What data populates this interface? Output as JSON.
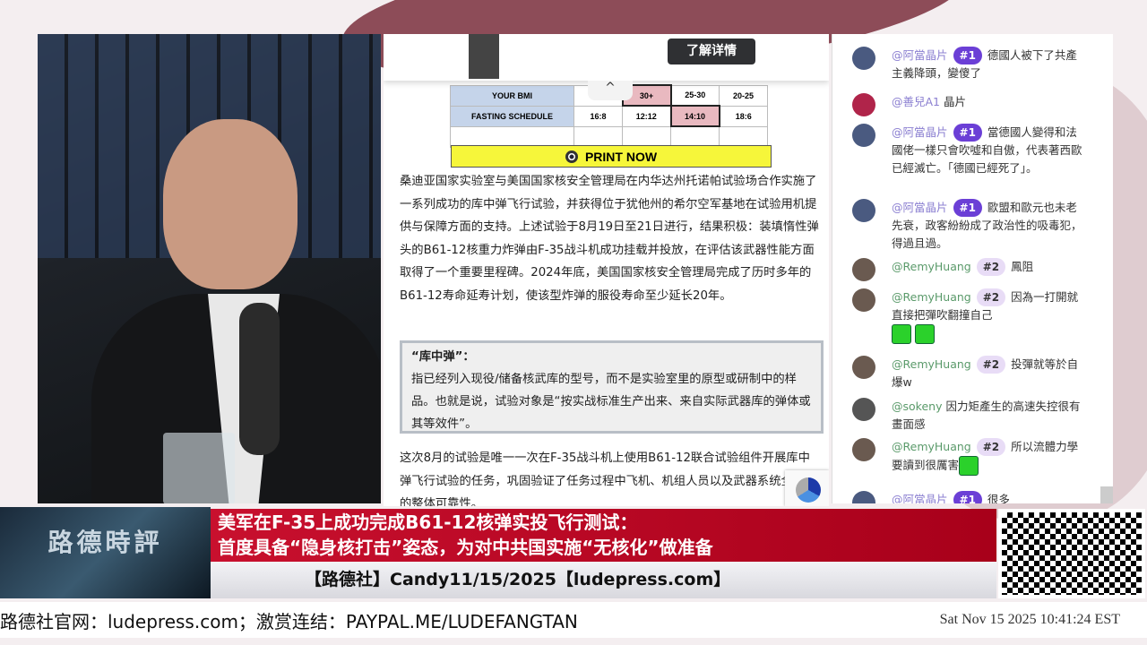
{
  "ad": {
    "button_label": "了解详情"
  },
  "bmi_table": {
    "row1": {
      "label": "YOUR BMI",
      "cells": [
        "",
        "30+",
        "25-30",
        "20-25"
      ]
    },
    "row2": {
      "label": "FASTING SCHEDULE",
      "cells": [
        "16:8",
        "12:12",
        "14:10",
        "18:6"
      ]
    },
    "print_label": "PRINT NOW",
    "collapse_icon": "^"
  },
  "article": {
    "paragraph1": "桑迪亚国家实验室与美国国家核安全管理局在内华达州托诺帕试验场合作实施了一系列成功的库中弹飞行试验，并获得位于犹他州的希尔空军基地在试验用机提供与保障方面的支持。上述试验于8月19日至21日进行，结果积极：装填惰性弹头的B61-12核重力炸弹由F-35战斗机成功挂载并投放，在评估该武器性能方面取得了一个重要里程碑。2024年底，美国国家核安全管理局完成了历时多年的B61-12寿命延寿计划，使该型炸弹的服役寿命至少延长20年。",
    "quote_title": "“库中弹”：",
    "quote_body": "指已经列入现役/储备核武库的型号，而不是实验室里的原型或研制中的样品。也就是说，试验对象是“按实战标准生产出来、来自实际武器库的弹体或其等效件”。",
    "paragraph2": "这次8月的试验是唯一一次在F-35战斗机上使用B61-12联合试验组件开展库中弹飞行试验的任务，巩固验证了任务过程中飞机、机组人员以及武器系统全流程的整体可靠性。"
  },
  "chat": [
    {
      "name": "@阿當晶片",
      "badge": "#1",
      "text": "德國人被下了共產主義降頭，變傻了",
      "avatar": "#4a5a80"
    },
    {
      "name": "@善兒A1",
      "badge": "",
      "text": "晶片",
      "avatar": "#b0244a"
    },
    {
      "name": "@阿當晶片",
      "badge": "#1",
      "text": "當德國人變得和法國佬一樣只會吹噓和自傲，代表著西歐已經滅亡。「德國已經死了」。",
      "avatar": "#4a5a80"
    },
    {
      "name": "@阿當晶片",
      "badge": "#1",
      "text": "歐盟和歐元也未老先衰，政客紛紛成了政治性的吸毒犯，得過且過。",
      "avatar": "#4a5a80"
    },
    {
      "name": "@RemyHuang",
      "badge": "#2",
      "text": "鳳阻",
      "avatar": "#6a5a50"
    },
    {
      "name": "@RemyHuang",
      "badge": "#2",
      "text": "因為一打開就直接把彈吹翻撞自己",
      "avatar": "#6a5a50"
    },
    {
      "name": "@RemyHuang",
      "badge": "#2",
      "text": "投彈就等於自爆w",
      "avatar": "#6a5a50"
    },
    {
      "name": "@sokeny",
      "badge": "",
      "text": "因力矩產生的高速失控很有畫面感",
      "avatar": "#555"
    },
    {
      "name": "@RemyHuang",
      "badge": "#2",
      "text": "所以流體力學要讀到很厲害",
      "avatar": "#6a5a50"
    },
    {
      "name": "@阿當晶片",
      "badge": "#1",
      "text": "很多",
      "avatar": "#4a5a80"
    }
  ],
  "banner": {
    "logo": "路德時評",
    "headline1": "美军在F-35上成功完成B61-12核弹实投飞行测试：",
    "headline2": "首度具备“隐身核打击”姿态，为对中共国实施“无核化”做准备",
    "subline": "【路德社】Candy11/15/2025【ludepress.com】"
  },
  "ticker": {
    "text": "路德社官网：ludepress.com；激赏连结：PAYPAL.ME/LUDEFANGTAN",
    "timestamp": "Sat Nov 15 2025 10:41:24 EST"
  }
}
